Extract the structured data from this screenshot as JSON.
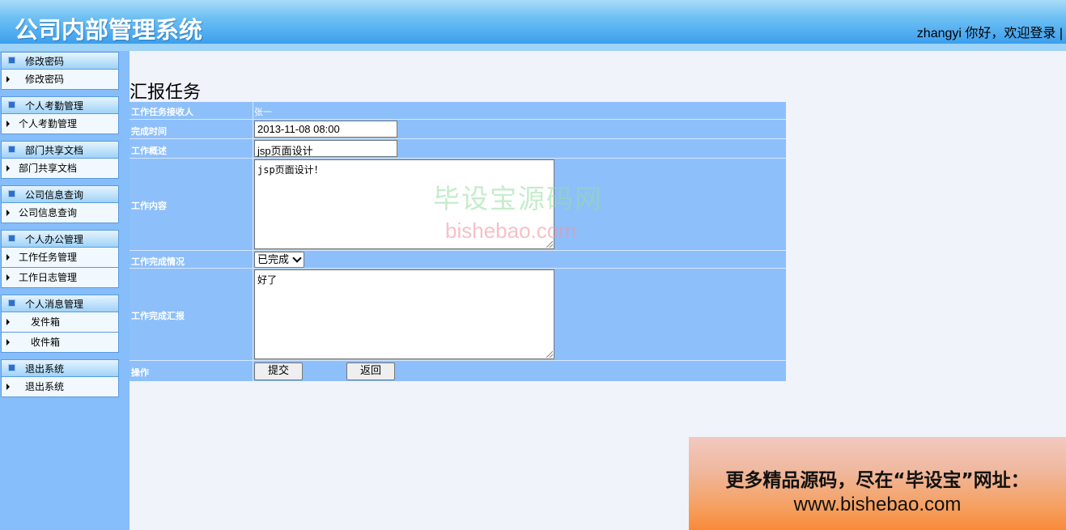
{
  "header": {
    "app_title": "公司内部管理系统",
    "welcome": "zhangyi 你好，欢迎登录 |"
  },
  "sidebar": {
    "groups": [
      {
        "title": "修改密码",
        "items": [
          "修改密码"
        ]
      },
      {
        "title": "个人考勤管理",
        "items": [
          "个人考勤管理"
        ]
      },
      {
        "title": "部门共享文档",
        "items": [
          "部门共享文档"
        ]
      },
      {
        "title": "公司信息查询",
        "items": [
          "公司信息查询"
        ]
      },
      {
        "title": "个人办公管理",
        "items": [
          "工作任务管理",
          "工作日志管理"
        ]
      },
      {
        "title": "个人消息管理",
        "items": [
          "发件箱",
          "收件箱"
        ]
      },
      {
        "title": "退出系统",
        "items": [
          "退出系统"
        ]
      }
    ]
  },
  "main": {
    "page_title": "汇报任务",
    "form": {
      "receiver_label": "工作任务接收人",
      "receiver_value": "张一",
      "finish_time_label": "完成时间",
      "finish_time_value": "2013-11-08 08:00",
      "summary_label": "工作概述",
      "summary_value": "jsp页面设计",
      "content_label": "工作内容",
      "content_value": "jsp页面设计！",
      "status_label": "工作完成情况",
      "status_value": "已完成",
      "report_label": "工作完成汇报",
      "report_value": "好了",
      "action_label": "操作",
      "submit_label": "提交",
      "back_label": "返回"
    }
  },
  "watermark": {
    "cn": "毕设宝源码网",
    "en": "bishebao.com"
  },
  "promo": {
    "line1": "更多精品源码，尽在“毕设宝”网址：",
    "line2": "www.bishebao.com"
  }
}
